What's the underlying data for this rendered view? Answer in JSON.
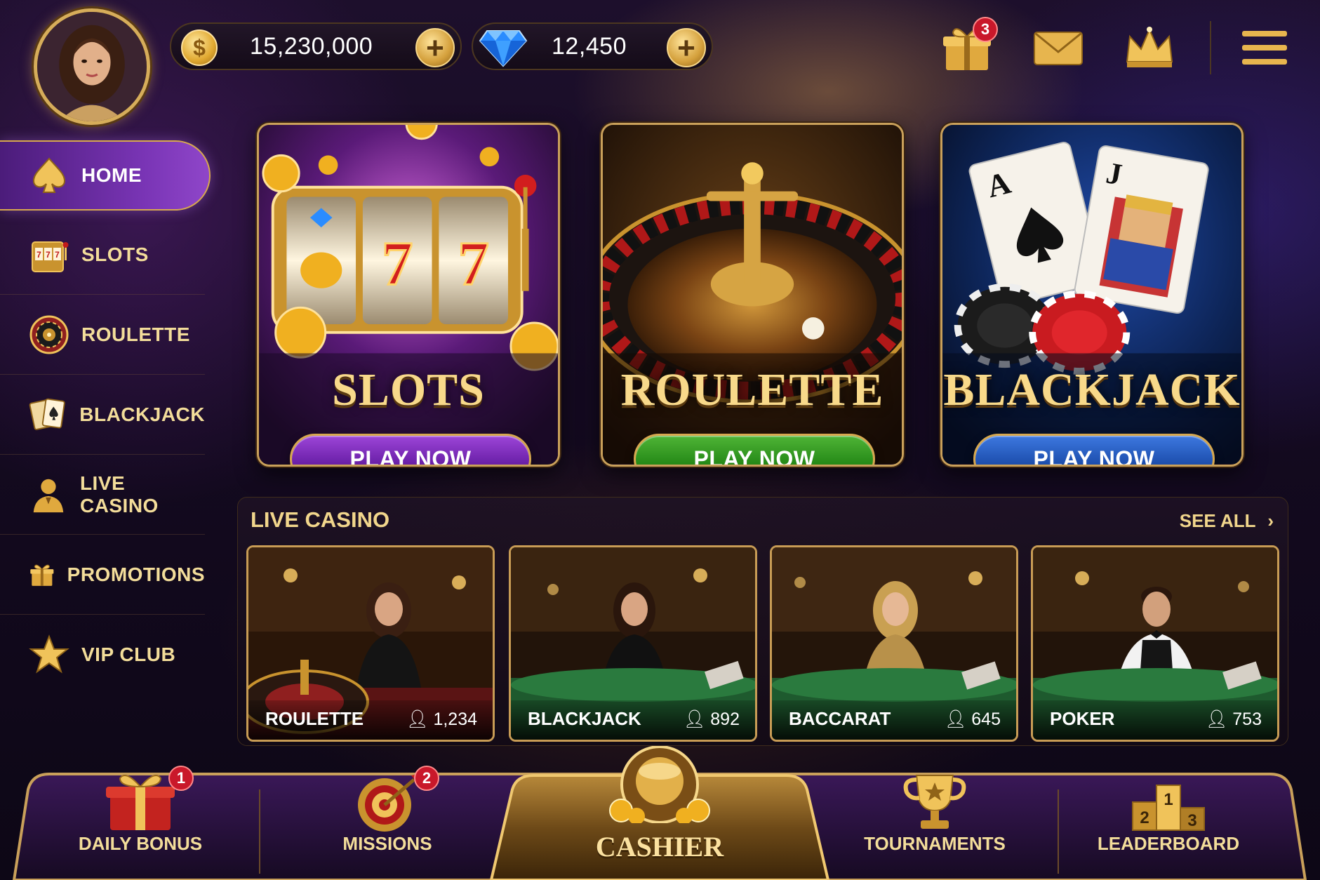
{
  "header": {
    "coins": "15,230,000",
    "gems": "12,450",
    "gift_badge": "3"
  },
  "sidebar": {
    "items": [
      {
        "label": "HOME",
        "icon": "spade-icon",
        "active": true
      },
      {
        "label": "SLOTS",
        "icon": "slot-machine-icon"
      },
      {
        "label": "ROULETTE",
        "icon": "roulette-wheel-icon"
      },
      {
        "label": "BLACKJACK",
        "icon": "cards-icon"
      },
      {
        "label": "LIVE CASINO",
        "icon": "dealer-icon"
      },
      {
        "label": "PROMOTIONS",
        "icon": "gift-icon"
      },
      {
        "label": "VIP CLUB",
        "icon": "star-icon"
      }
    ]
  },
  "games": [
    {
      "title": "SLOTS",
      "button": "PLAY NOW",
      "color": "#7b2fb4"
    },
    {
      "title": "ROULETTE",
      "button": "PLAY NOW",
      "color": "#2b8a1c"
    },
    {
      "title": "BLACKJACK",
      "button": "PLAY NOW",
      "color": "#1d4fae"
    }
  ],
  "live_casino": {
    "heading": "LIVE CASINO",
    "see_all": "SEE ALL",
    "tables": [
      {
        "name": "ROULETTE",
        "players": "1,234"
      },
      {
        "name": "BLACKJACK",
        "players": "892"
      },
      {
        "name": "BACCARAT",
        "players": "645"
      },
      {
        "name": "POKER",
        "players": "753"
      }
    ]
  },
  "bottom_nav": {
    "daily_bonus": {
      "label": "DAILY BONUS",
      "badge": "1"
    },
    "missions": {
      "label": "MISSIONS",
      "badge": "2"
    },
    "cashier": {
      "label": "CASHIER"
    },
    "tournaments": {
      "label": "TOURNAMENTS"
    },
    "leaderboard": {
      "label": "LEADERBOARD",
      "podium": [
        "2",
        "1",
        "3"
      ]
    }
  },
  "colors": {
    "gold": "#d7a84f",
    "purple": "#7b2fb4",
    "green": "#2b8a1c",
    "blue": "#1d4fae",
    "badge_red": "#c9182a"
  }
}
